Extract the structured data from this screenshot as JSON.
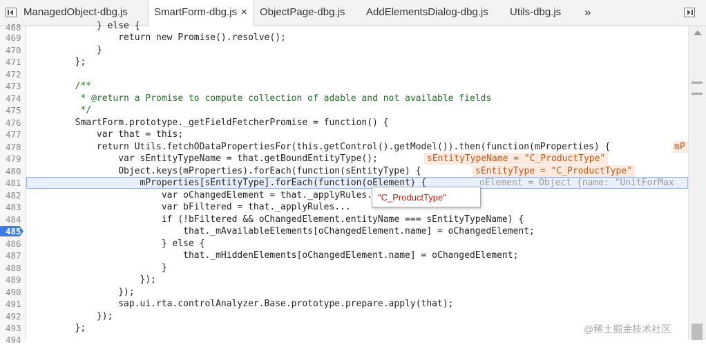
{
  "tabs": [
    {
      "label": "ManagedObject-dbg.js"
    },
    {
      "label": "SmartForm-dbg.js",
      "close": "×"
    },
    {
      "label": "ObjectPage-dbg.js"
    },
    {
      "label": "AddElementsDialog-dbg.js"
    },
    {
      "label": "Utils-dbg.js"
    }
  ],
  "more_tabs_label": "»",
  "editor": {
    "breakpoint_line": "485",
    "lines": [
      {
        "n": "468",
        "t": "            } else {"
      },
      {
        "n": "469",
        "t": "                return new Promise().resolve();"
      },
      {
        "n": "470",
        "t": "            }"
      },
      {
        "n": "471",
        "t": "        };"
      },
      {
        "n": "472",
        "t": ""
      },
      {
        "n": "473",
        "t": "        /**"
      },
      {
        "n": "474",
        "t": "         * @return a Promise to compute collection of adable and not available fields"
      },
      {
        "n": "475",
        "t": "         */"
      },
      {
        "n": "476",
        "t": "        SmartForm.prototype._getFieldFetcherPromise = function() {"
      },
      {
        "n": "477",
        "t": "            var that = this;"
      },
      {
        "n": "478",
        "t": "            return Utils.fetchODataPropertiesFor(this.getControl().getModel()).then(function(mProperties) {"
      },
      {
        "n": "479",
        "t": "                var sEntityTypeName = that.getBoundEntityType();"
      },
      {
        "n": "480",
        "t": "                Object.keys(mProperties).forEach(function(sEntityType) {"
      },
      {
        "n": "481",
        "t": "                    mProperties[sEntityType].forEach(function(oElement) {"
      },
      {
        "n": "482",
        "t": "                        var oChangedElement = that._applyRules..."
      },
      {
        "n": "483",
        "t": "                        var bFiltered = that._applyRules..."
      },
      {
        "n": "484",
        "t": "                        if (!bFiltered && oChangedElement.entityName === sEntityTypeName) {"
      },
      {
        "n": "485",
        "t": "                            that._mAvailableElements[oChangedElement.name] = oChangedElement;"
      },
      {
        "n": "486",
        "t": "                        } else {"
      },
      {
        "n": "487",
        "t": "                            that._mHiddenElements[oChangedElement.name] = oChangedElement;"
      },
      {
        "n": "488",
        "t": "                        }"
      },
      {
        "n": "489",
        "t": "                    });"
      },
      {
        "n": "490",
        "t": "                });"
      },
      {
        "n": "491",
        "t": "                sap.ui.rta.controlAnalyzer.Base.prototype.prepare.apply(that);"
      },
      {
        "n": "492",
        "t": "            });"
      },
      {
        "n": "493",
        "t": "        };"
      },
      {
        "n": "494",
        "t": ""
      }
    ],
    "inline_values": {
      "l478": "mP",
      "l479": "sEntityTypeName = \"C_ProductType\"",
      "l480": "sEntityType = \"C_ProductType\"",
      "l481": "oElement = Object {name: \"UnitForMax"
    },
    "tooltip": "\"C_ProductType\""
  },
  "watermark": "@稀土掘金技术社区",
  "colors": {
    "keyword": "#aa0da1",
    "comment": "#236e25",
    "breakpoint": "#3b7de0",
    "inline_bg": "#fde9dd"
  }
}
